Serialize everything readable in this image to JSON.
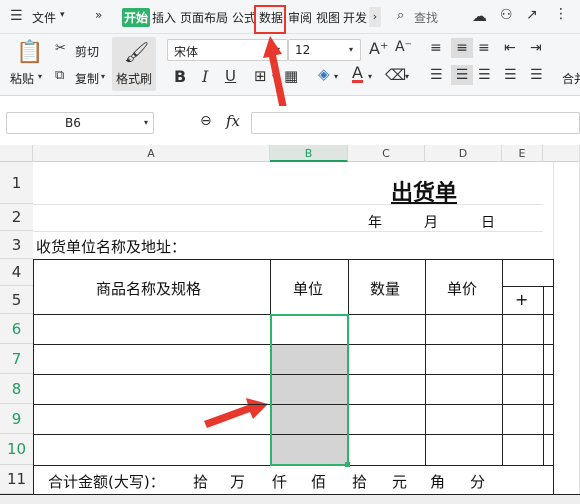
{
  "menubar": {
    "file": "文件",
    "tabs": [
      "开始",
      "插入",
      "页面布局",
      "公式",
      "数据",
      "审阅",
      "视图",
      "开发"
    ],
    "search": "查找"
  },
  "ribbon": {
    "paste": "粘贴",
    "cut": "剪切",
    "copy": "复制",
    "format_painter": "格式刷",
    "font_name": "宋体",
    "font_size": "12",
    "bold": "B",
    "italic": "I",
    "underline": "U",
    "merge": "合并"
  },
  "formula": {
    "cell_ref": "B6",
    "fx": "fx",
    "value": ""
  },
  "columns": [
    "A",
    "B",
    "C",
    "D",
    "E"
  ],
  "rows": [
    "1",
    "2",
    "3",
    "4",
    "5",
    "6",
    "7",
    "8",
    "9",
    "10",
    "11"
  ],
  "sheet": {
    "title": "出货单",
    "date_year": "年",
    "date_month": "月",
    "date_day": "日",
    "consignee": "收货单位名称及地址：",
    "col_item": "商品名称及规格",
    "col_unit": "单位",
    "col_qty": "数量",
    "col_price": "单价",
    "plus": "+",
    "total_label": "合计金额(大写)：",
    "amount_units": [
      "拾",
      "万",
      "仟",
      "佰",
      "拾",
      "元",
      "角",
      "分"
    ]
  }
}
